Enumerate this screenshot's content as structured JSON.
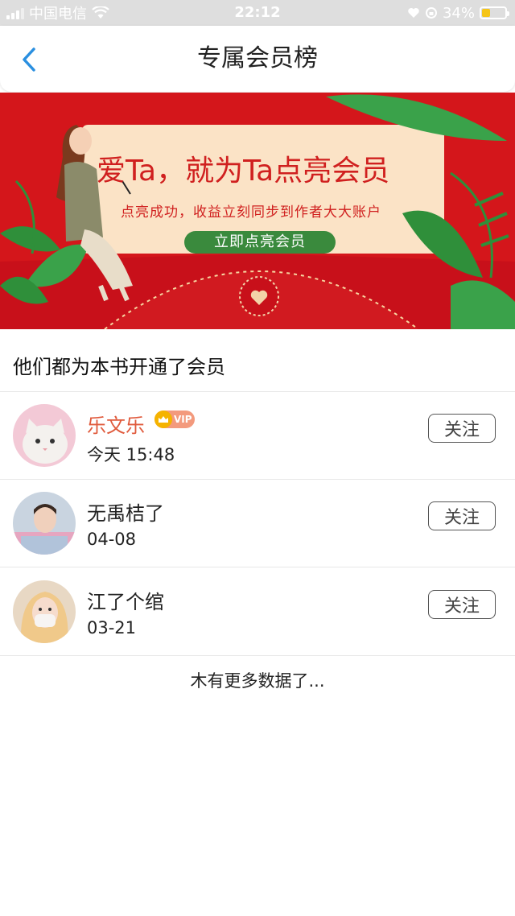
{
  "status_bar": {
    "carrier": "中国电信",
    "time": "22:12",
    "battery": "34%",
    "battery_level": 0.34
  },
  "nav": {
    "title": "专属会员榜"
  },
  "banner": {
    "headline": "爱Ta，就为Ta点亮会员",
    "subline": "点亮成功，收益立刻同步到作者大大账户",
    "cta_label": "立即点亮会员",
    "colors": {
      "background": "#d4161b",
      "card": "#fbe3c6",
      "cta": "#3a8a3d"
    }
  },
  "section": {
    "title": "他们都为本书开通了会员"
  },
  "members": [
    {
      "name": "乐文乐",
      "is_vip": true,
      "vip_label": "VIP",
      "time": "今天 15:48",
      "follow_label": "关注"
    },
    {
      "name": "无禹桔了",
      "is_vip": false,
      "time": "04-08",
      "follow_label": "关注"
    },
    {
      "name": "江了个绾",
      "is_vip": false,
      "time": "03-21",
      "follow_label": "关注"
    }
  ],
  "footer": {
    "no_more_text": "木有更多数据了..."
  },
  "colors": {
    "accent_back": "#2a8fe0",
    "vip_name": "#e05a3c"
  }
}
